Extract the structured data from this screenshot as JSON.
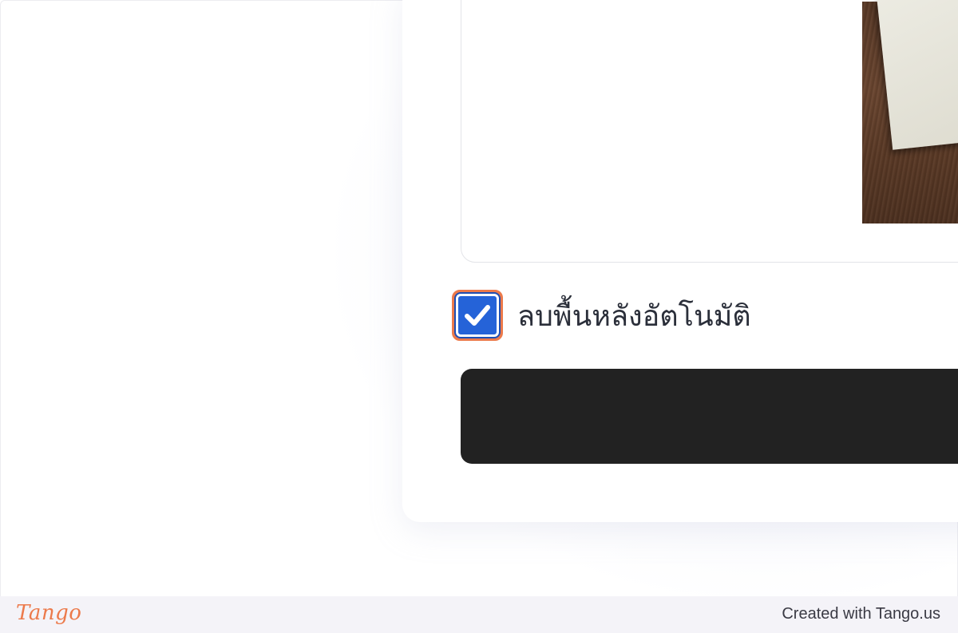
{
  "uploader": {
    "auto_remove_background_label": "ลบพื้นหลังอัตโนมัติ",
    "auto_remove_background_checked": true,
    "submit_button_label": ""
  },
  "footer": {
    "logo_text": "Tango",
    "credit_text": "Created with Tango.us"
  },
  "colors": {
    "highlight": "#ec7a4b",
    "checkbox_fill": "#2563d8",
    "button_fill": "#222222",
    "footer_bg": "#f4f3f8"
  },
  "icons": {
    "checkbox": "checkmark-icon"
  }
}
